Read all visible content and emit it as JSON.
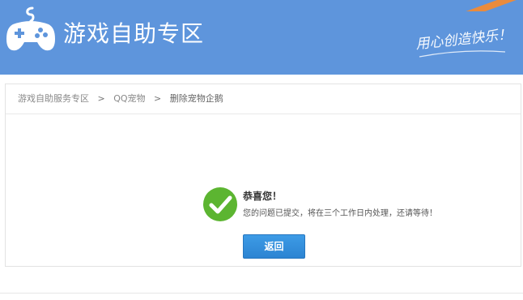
{
  "header": {
    "title": "游戏自助专区",
    "slogan": "用心创造快乐！",
    "logo_icon": "gamepad-icon",
    "background_color": "#5e95dc"
  },
  "breadcrumb": {
    "items": [
      "游戏自助服务专区",
      "QQ宠物",
      "删除宠物企鹅"
    ],
    "separator": ">"
  },
  "result": {
    "icon": "check-circle-icon",
    "icon_color": "#5cb531",
    "title": "恭喜您！",
    "message": "您的问题已提交，将在三个工作日内处理，还请等待！"
  },
  "actions": {
    "back_label": "返回",
    "button_color": "#2f8ad8"
  }
}
